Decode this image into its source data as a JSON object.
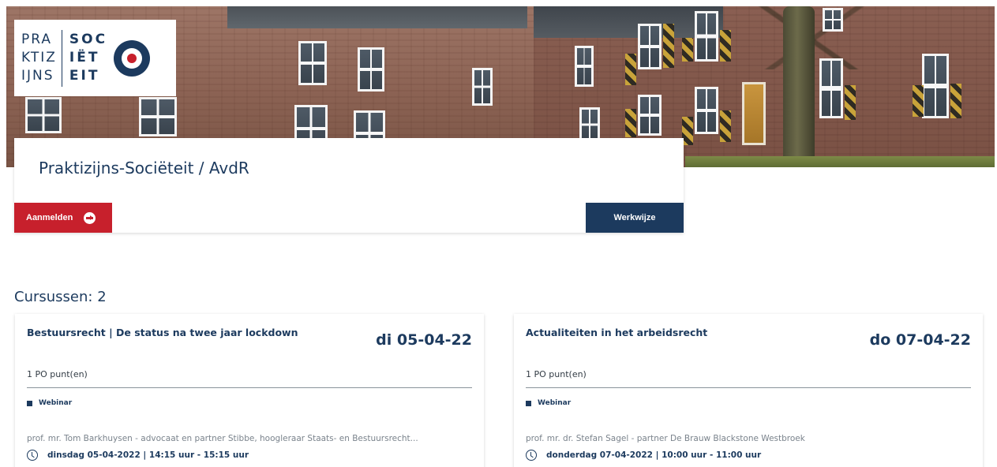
{
  "logo": {
    "left_lines": [
      "PRA",
      "KTIZ",
      "IJNS"
    ],
    "right_lines": [
      "SOC",
      "IËT",
      "EIT"
    ]
  },
  "header": {
    "title": "Praktizijns-Sociëteit / AvdR",
    "register_label": "Aanmelden",
    "method_label": "Werkwijze"
  },
  "courses": {
    "count_label": "Cursussen: 2",
    "items": [
      {
        "title": "Bestuursrecht | De status na twee jaar lockdown",
        "date": "di 05-04-22",
        "points": "1 PO punt(en)",
        "type": "Webinar",
        "speaker": "prof. mr. Tom Barkhuysen - advocaat en partner Stibbe, hoogleraar Staats- en Bestuursrecht...",
        "time": "dinsdag 05-04-2022 | 14:15 uur - 15:15 uur"
      },
      {
        "title": "Actualiteiten in het arbeidsrecht",
        "date": "do 07-04-22",
        "points": "1 PO punt(en)",
        "type": "Webinar",
        "speaker": "prof. mr. dr. Stefan Sagel - partner De Brauw Blackstone Westbroek",
        "time": "donderdag 07-04-2022 | 10:00 uur - 11:00 uur"
      }
    ]
  },
  "colors": {
    "brand_navy": "#1c3a5e",
    "brand_red": "#c7202c"
  }
}
